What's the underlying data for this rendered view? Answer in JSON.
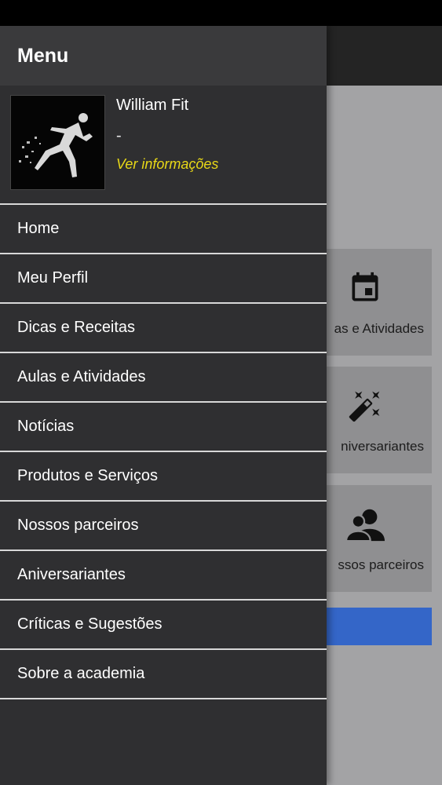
{
  "drawer": {
    "title": "Menu",
    "profile": {
      "name": "William Fit",
      "subtitle": "-",
      "link": "Ver informações"
    },
    "items": [
      {
        "label": "Home"
      },
      {
        "label": "Meu Perfil"
      },
      {
        "label": "Dicas e Receitas"
      },
      {
        "label": "Aulas e Atividades"
      },
      {
        "label": "Notícias"
      },
      {
        "label": "Produtos e Serviços"
      },
      {
        "label": "Nossos parceiros"
      },
      {
        "label": "Aniversariantes"
      },
      {
        "label": "Críticas e Sugestões"
      },
      {
        "label": "Sobre a academia"
      }
    ]
  },
  "background": {
    "cards": [
      {
        "label": "as e Atividades",
        "icon": "calendar-icon"
      },
      {
        "label": "niversariantes",
        "icon": "magic-wand-icon"
      },
      {
        "label": "ssos parceiros",
        "icon": "people-icon"
      }
    ]
  },
  "colors": {
    "drawer_bg": "#2f2f31",
    "drawer_header": "#3a3a3c",
    "link_yellow": "#e8d817",
    "button_blue": "#3466c8",
    "scrim_gray": "#a3a3a5"
  }
}
